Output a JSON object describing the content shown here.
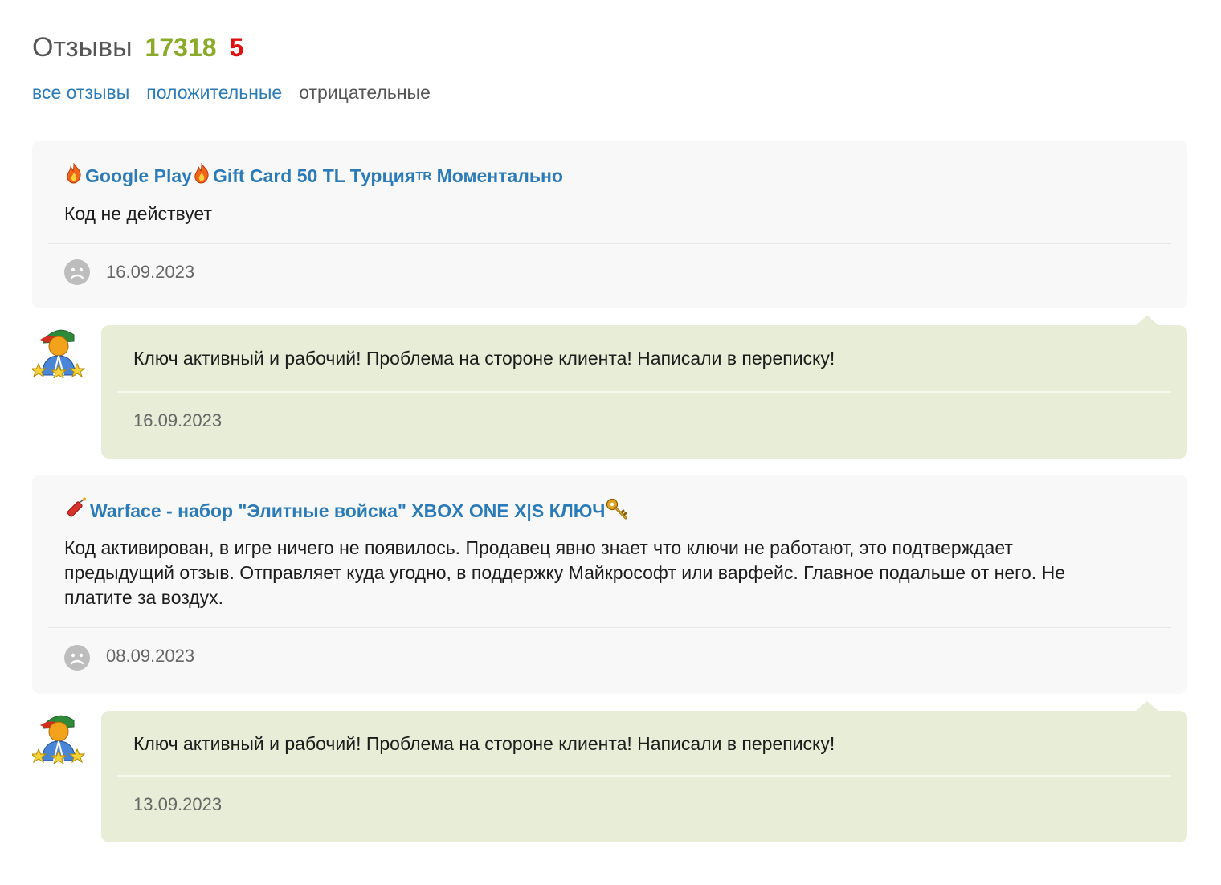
{
  "header": {
    "title": "Отзывы",
    "positive_count": "17318",
    "negative_count": "5"
  },
  "filters": {
    "all": "все отзывы",
    "positive": "положительные",
    "negative": "отрицательные",
    "active": "negative"
  },
  "reviews": [
    {
      "product_icon": "fire-icon",
      "product_parts": [
        "Google Play ",
        "Gift Card 50 TL Турция",
        "TR",
        " Моментально"
      ],
      "text": "Код не действует",
      "sentiment": "negative",
      "date": "16.09.2023",
      "reply": {
        "text": "Ключ активный и рабочий! Проблема на стороне клиента! Написали в переписку!",
        "date": "16.09.2023"
      }
    },
    {
      "product_icon": "firecracker-icon",
      "product_title": "Warface - набор \"Элитные войска\" XBOX ONE X|S КЛЮЧ",
      "product_suffix_icon": "key-icon",
      "text": "Код активирован, в игре ничего не появилось. Продавец явно знает что ключи не работают, это подтверждает предыдущий отзыв. Отправляет куда угодно, в поддержку Майкрософт или варфейс. Главное подальше от него. Не платите за воздух.",
      "sentiment": "negative",
      "date": "08.09.2023",
      "reply": {
        "text": "Ключ активный и рабочий! Проблема на стороне клиента! Написали в переписку!",
        "date": "13.09.2023"
      }
    }
  ],
  "colors": {
    "link": "#2a7bb8",
    "positive": "#8aaa2a",
    "negative": "#e01010",
    "card_bg": "#f8f8f8",
    "reply_bg": "#e7edd7"
  }
}
